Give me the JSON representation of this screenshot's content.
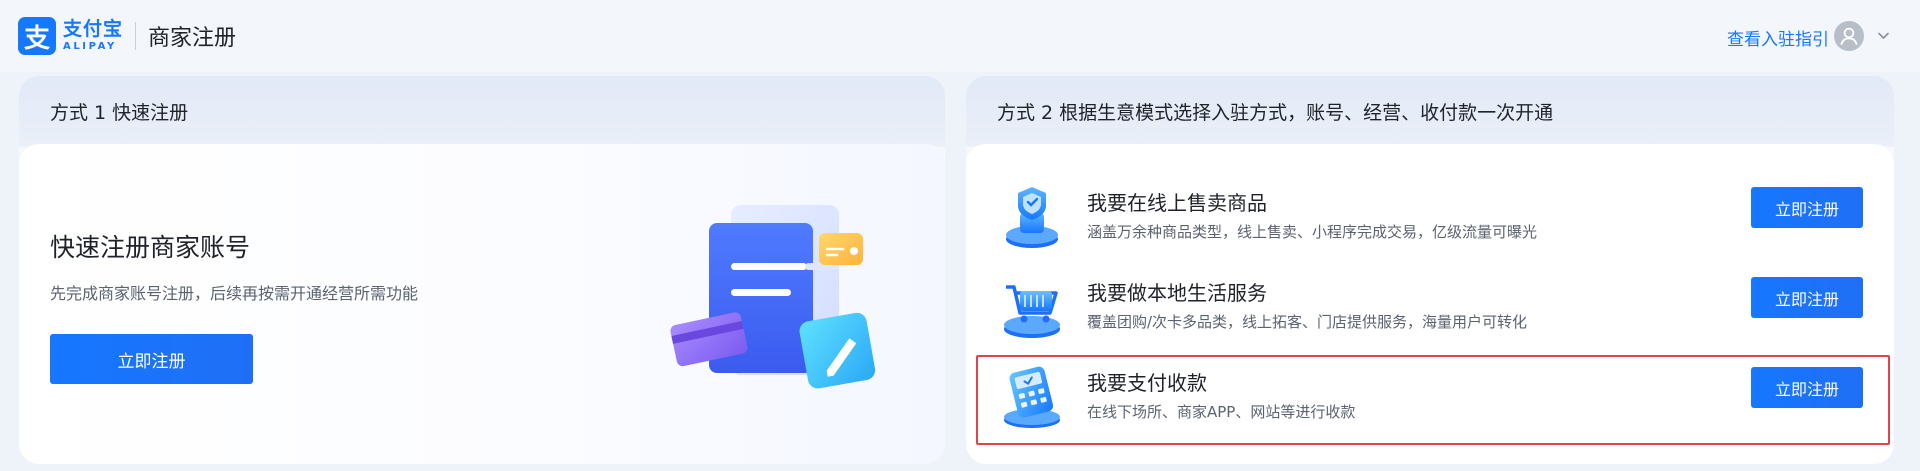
{
  "header": {
    "logo_cn": "支付宝",
    "logo_en": "ALIPAY",
    "logo_mark": "支",
    "subtitle": "商家注册",
    "guide_link": "查看入驻指引",
    "avatar_icon": "user-icon",
    "dropdown_icon": "chevron-down-icon"
  },
  "left_card": {
    "title": "方式 1 快速注册",
    "heading": "快速注册商家账号",
    "description": "先完成商家账号注册，后续再按需开通经营所需功能",
    "button": "立即注册"
  },
  "right_card": {
    "title": "方式 2 根据生意模式选择入驻方式，账号、经营、收付款一次开通",
    "options": [
      {
        "title": "我要在线上售卖商品",
        "description": "涵盖万余种商品类型，线上售卖、小程序完成交易，亿级流量可曝光",
        "button": "立即注册",
        "icon": "online-store-icon"
      },
      {
        "title": "我要做本地生活服务",
        "description": "覆盖团购/次卡多品类，线上拓客、门店提供服务，海量用户可转化",
        "button": "立即注册",
        "icon": "shopping-cart-icon"
      },
      {
        "title": "我要支付收款",
        "description": "在线下场所、商家APP、网站等进行收款",
        "button": "立即注册",
        "icon": "pos-terminal-icon"
      }
    ]
  },
  "colors": {
    "accent": "#1677ff",
    "highlight": "#e4424e",
    "background": "#eef2f9"
  }
}
